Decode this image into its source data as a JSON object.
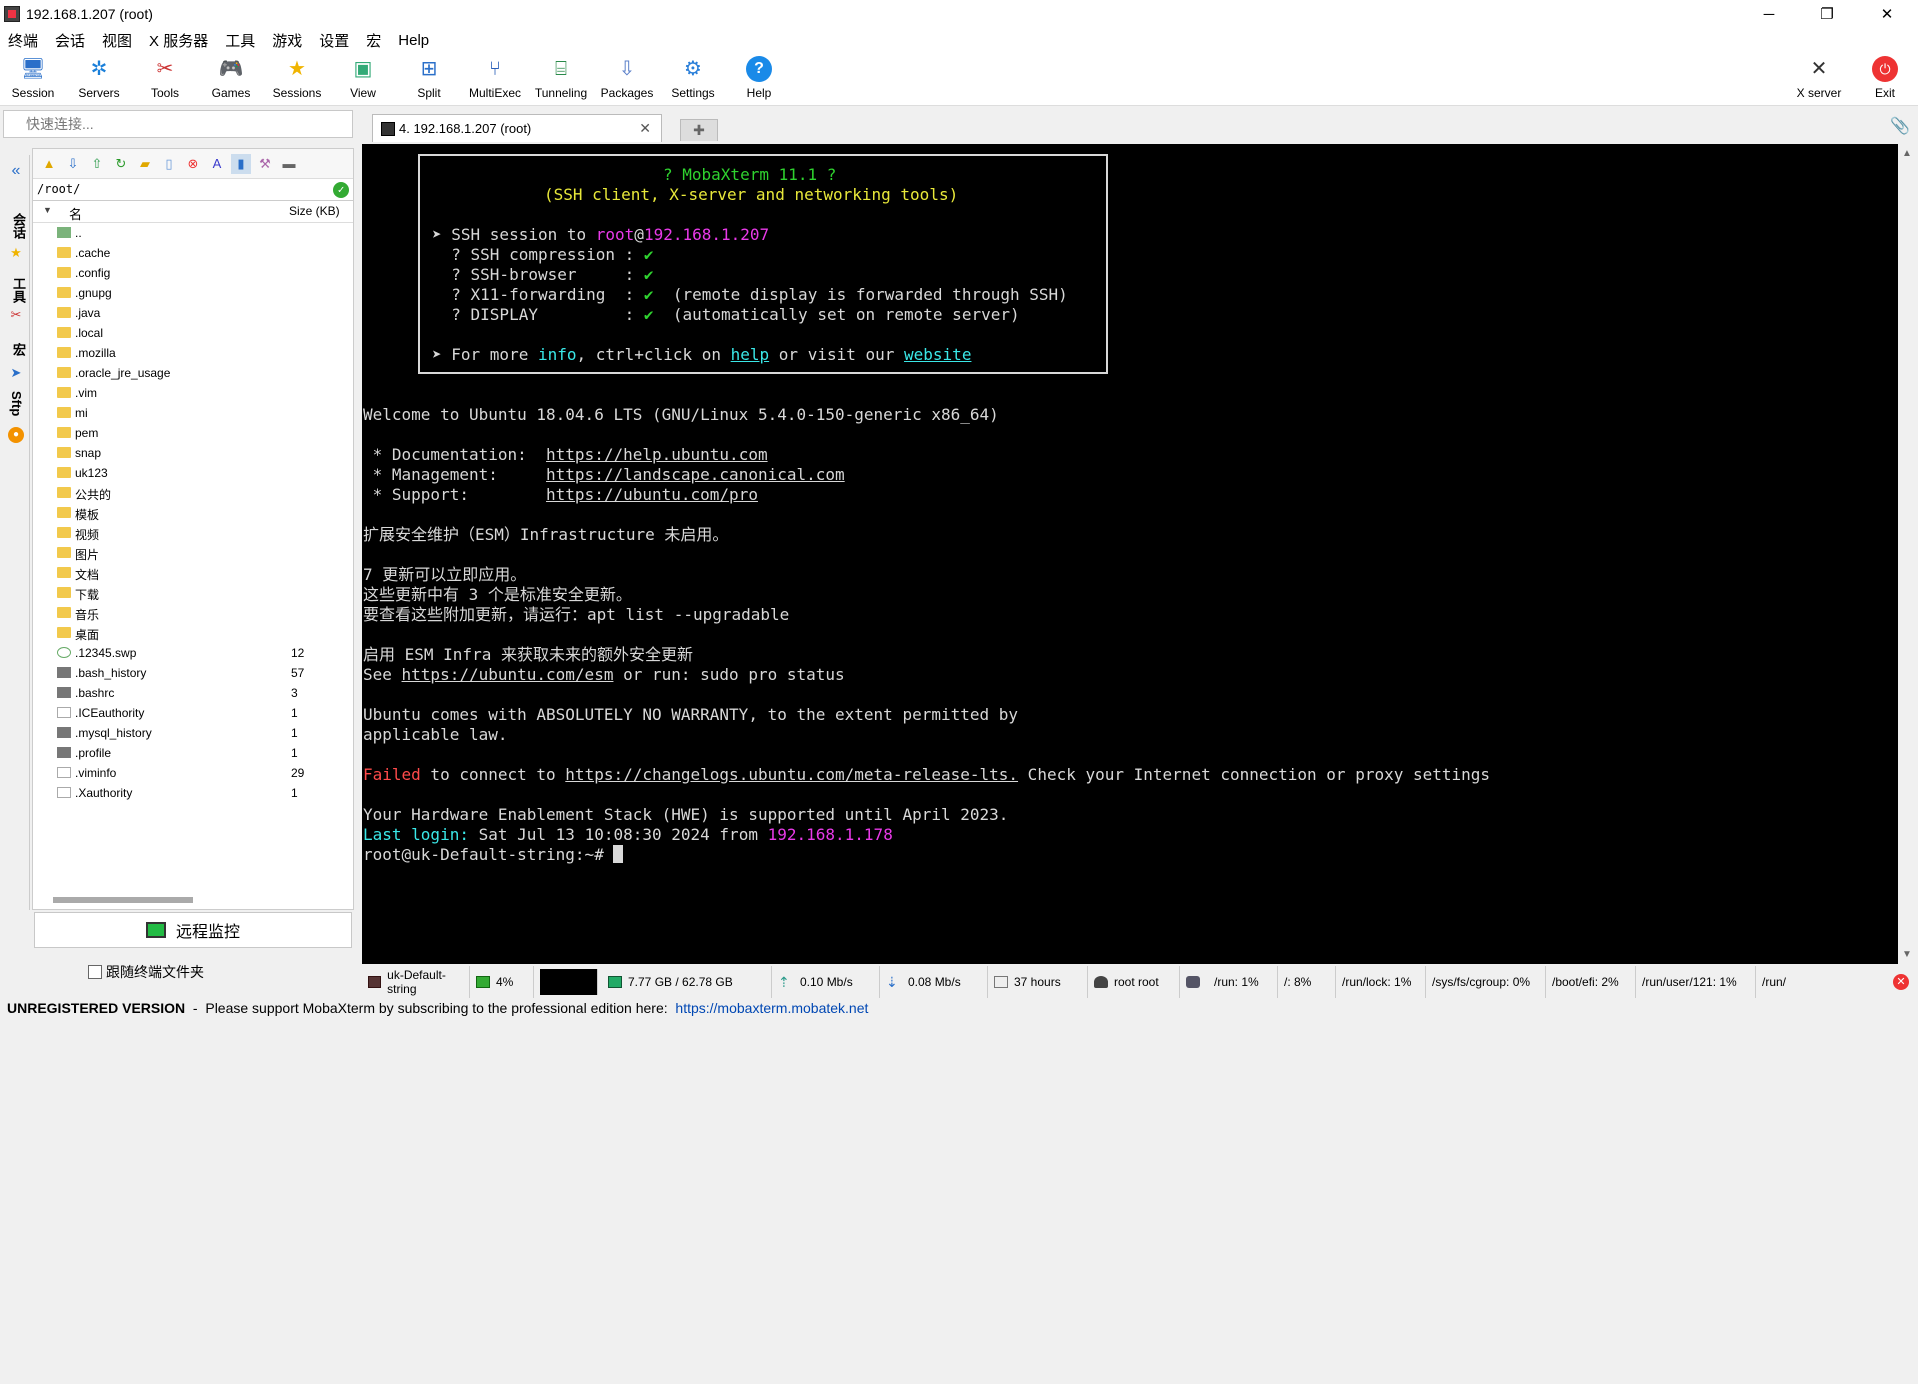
{
  "window": {
    "title": "192.168.1.207 (root)"
  },
  "menu": [
    "终端",
    "会话",
    "视图",
    "X 服务器",
    "工具",
    "游戏",
    "设置",
    "宏",
    "Help"
  ],
  "toolbar": [
    {
      "label": "Session",
      "icon": "session-icon"
    },
    {
      "label": "Servers",
      "icon": "servers-icon"
    },
    {
      "label": "Tools",
      "icon": "tools-icon"
    },
    {
      "label": "Games",
      "icon": "games-icon"
    },
    {
      "label": "Sessions",
      "icon": "sessions-star-icon"
    },
    {
      "label": "View",
      "icon": "view-icon"
    },
    {
      "label": "Split",
      "icon": "split-icon"
    },
    {
      "label": "MultiExec",
      "icon": "multiexec-icon"
    },
    {
      "label": "Tunneling",
      "icon": "tunneling-icon"
    },
    {
      "label": "Packages",
      "icon": "packages-icon"
    },
    {
      "label": "Settings",
      "icon": "settings-icon"
    },
    {
      "label": "Help",
      "icon": "help-icon"
    }
  ],
  "toolbar_right": [
    {
      "label": "X server",
      "icon": "xserver-icon"
    },
    {
      "label": "Exit",
      "icon": "power-icon"
    }
  ],
  "quick_connect": {
    "placeholder": "快速连接..."
  },
  "tab": {
    "label": "4. 192.168.1.207 (root)"
  },
  "side_tabs": [
    "会话",
    "工具",
    "宏",
    "Sftp"
  ],
  "file_panel": {
    "path": "/root/",
    "col_name": "名",
    "col_size": "Size (KB)",
    "rows": [
      {
        "name": "..",
        "size": "",
        "type": "up"
      },
      {
        "name": ".cache",
        "size": "",
        "type": "folder"
      },
      {
        "name": ".config",
        "size": "",
        "type": "folder"
      },
      {
        "name": ".gnupg",
        "size": "",
        "type": "folder"
      },
      {
        "name": ".java",
        "size": "",
        "type": "folder"
      },
      {
        "name": ".local",
        "size": "",
        "type": "folder"
      },
      {
        "name": ".mozilla",
        "size": "",
        "type": "folder"
      },
      {
        "name": ".oracle_jre_usage",
        "size": "",
        "type": "folder"
      },
      {
        "name": ".vim",
        "size": "",
        "type": "folder"
      },
      {
        "name": "mi",
        "size": "",
        "type": "folder"
      },
      {
        "name": "pem",
        "size": "",
        "type": "folder"
      },
      {
        "name": "snap",
        "size": "",
        "type": "folder"
      },
      {
        "name": "uk123",
        "size": "",
        "type": "folder"
      },
      {
        "name": "公共的",
        "size": "",
        "type": "folder"
      },
      {
        "name": "模板",
        "size": "",
        "type": "folder"
      },
      {
        "name": "视频",
        "size": "",
        "type": "folder"
      },
      {
        "name": "图片",
        "size": "",
        "type": "folder"
      },
      {
        "name": "文档",
        "size": "",
        "type": "folder"
      },
      {
        "name": "下载",
        "size": "",
        "type": "folder"
      },
      {
        "name": "音乐",
        "size": "",
        "type": "folder"
      },
      {
        "name": "桌面",
        "size": "",
        "type": "folder"
      },
      {
        "name": ".12345.swp",
        "size": "12",
        "type": "swp"
      },
      {
        "name": ".bash_history",
        "size": "57",
        "type": "bin"
      },
      {
        "name": ".bashrc",
        "size": "3",
        "type": "bin"
      },
      {
        "name": ".ICEauthority",
        "size": "1",
        "type": "file"
      },
      {
        "name": ".mysql_history",
        "size": "1",
        "type": "bin"
      },
      {
        "name": ".profile",
        "size": "1",
        "type": "bin"
      },
      {
        "name": ".viminfo",
        "size": "29",
        "type": "file"
      },
      {
        "name": ".Xauthority",
        "size": "1",
        "type": "file"
      }
    ]
  },
  "remote_monitor": {
    "label": "远程监控"
  },
  "follow_terminal": {
    "label": "跟随终端文件夹"
  },
  "terminal": {
    "banner_title": "? MobaXterm 11.1 ?",
    "banner_sub": "(SSH client, X-server and networking tools)",
    "ssh_prefix": "➤ SSH session to ",
    "ssh_user": "root",
    "ssh_host": "192.168.1.207",
    "compression": "  ? SSH compression : ",
    "browser": "  ? SSH-browser     : ",
    "x11": "  ? X11-forwarding  : ",
    "x11_note": "  (remote display is forwarded through SSH)",
    "display": "  ? DISPLAY         : ",
    "display_note": "  (automatically set on remote server)",
    "check": "✔",
    "more_prefix": "➤ For more ",
    "more_info": "info",
    "more_mid": ", ctrl+click on ",
    "more_help": "help",
    "more_mid2": " or visit our ",
    "more_website": "website",
    "welcome": "Welcome to Ubuntu 18.04.6 LTS (GNU/Linux 5.4.0-150-generic x86_64)",
    "doc_label": " * Documentation:  ",
    "doc_url": "https://help.ubuntu.com",
    "mgmt_label": " * Management:     ",
    "mgmt_url": "https://landscape.canonical.com",
    "support_label": " * Support:        ",
    "support_url": "https://ubuntu.com/pro",
    "esm_line": "扩展安全维护（ESM）Infrastructure 未启用。",
    "upd1": "7 更新可以立即应用。",
    "upd2": "这些更新中有 3 个是标准安全更新。",
    "upd3": "要查看这些附加更新，请运行：apt list --upgradable",
    "esm2": "启用 ESM Infra 来获取未来的额外安全更新",
    "see_prefix": "See ",
    "see_url": "https://ubuntu.com/esm",
    "see_suffix": " or run: sudo pro status",
    "warranty1": "Ubuntu comes with ABSOLUTELY NO WARRANTY, to the extent permitted by",
    "warranty2": "applicable law.",
    "failed": "Failed",
    "failed_mid": " to connect to ",
    "failed_url": "https://changelogs.ubuntu.com/meta-release-lts.",
    "failed_suffix": " Check your Internet connection or proxy settings",
    "hwe": "Your Hardware Enablement Stack (HWE) is supported until April 2023.",
    "last_login_label": "Last login:",
    "last_login_value": " Sat Jul 13 10:08:30 2024 from ",
    "last_login_ip": "192.168.1.178",
    "prompt": "root@uk-Default-string:~# "
  },
  "statusbar": [
    {
      "text": "uk-Default-string",
      "icon": "host-icon"
    },
    {
      "text": "4%",
      "icon": "cpu-icon"
    },
    {
      "text": "",
      "icon": "cpu-graph"
    },
    {
      "text": "7.77 GB / 62.78 GB",
      "icon": "memory-icon"
    },
    {
      "text": "0.10 Mb/s",
      "icon": "upload-icon"
    },
    {
      "text": "0.08 Mb/s",
      "icon": "download-icon"
    },
    {
      "text": "37 hours",
      "icon": "uptime-icon"
    },
    {
      "text": "root  root",
      "icon": "user-icon"
    },
    {
      "text": "/run: 1%",
      "icon": "disk-icon"
    },
    {
      "text": "/: 8%",
      "icon": ""
    },
    {
      "text": "/run/lock: 1%",
      "icon": ""
    },
    {
      "text": "/sys/fs/cgroup: 0%",
      "icon": ""
    },
    {
      "text": "/boot/efi: 2%",
      "icon": ""
    },
    {
      "text": "/run/user/121: 1%",
      "icon": ""
    },
    {
      "text": "/run/",
      "icon": ""
    }
  ],
  "footer": {
    "unregistered": "UNREGISTERED VERSION",
    "message": "  -  Please support MobaXterm by subscribing to the professional edition here:  ",
    "link": "https://mobaxterm.mobatek.net"
  }
}
